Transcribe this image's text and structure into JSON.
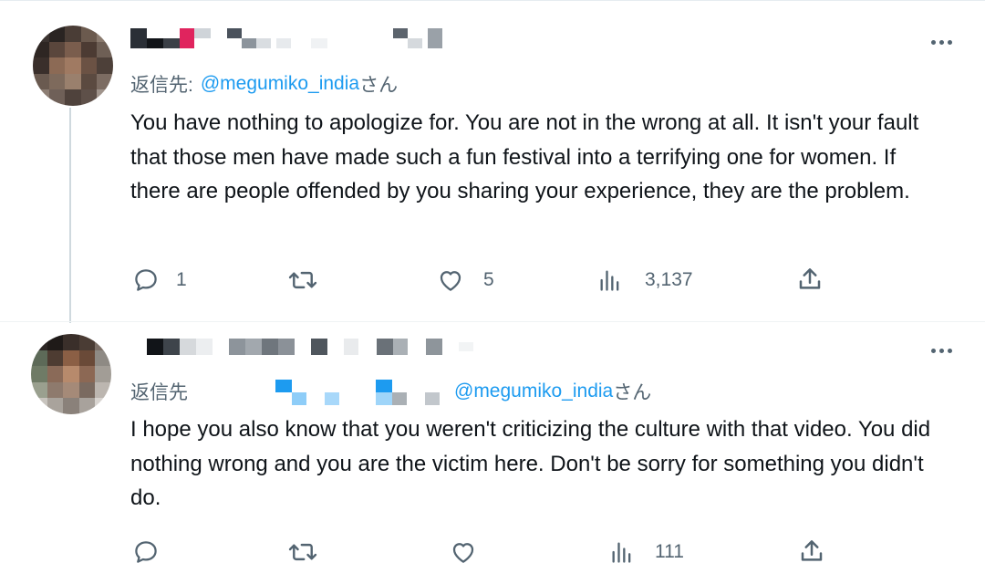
{
  "tweets": [
    {
      "reply_prefix": "返信先:",
      "reply_mention": "@megumiko_india",
      "reply_suffix": "さん",
      "text": "You have nothing to apologize for. You are not in the wrong at all. It isn't your fault that those men have made such a fun festival into a terrifying one for women. If there are people offended by you sharing your experience, they are the problem.",
      "actions": {
        "reply_count": "1",
        "retweet_count": "",
        "like_count": "5",
        "view_count": "3,137"
      }
    },
    {
      "reply_prefix": "返信先",
      "reply_mention": "@megumiko_india",
      "reply_suffix": "さん",
      "text": "I hope you also know that you weren't criticizing the culture with that video. You did nothing wrong and you are the victim here. Don't be sorry for something you didn't do.",
      "actions": {
        "reply_count": "",
        "retweet_count": "",
        "like_count": "",
        "view_count": "111"
      }
    }
  ],
  "icons": {
    "more": "more-dots-icon",
    "reply": "reply-bubble-icon",
    "retweet": "retweet-icon",
    "like": "heart-icon",
    "views": "views-bar-chart-icon",
    "share": "share-upload-icon"
  },
  "colors": {
    "mention": "#1d9bf0",
    "secondary_text": "#536471",
    "primary_text": "#0f1419"
  }
}
